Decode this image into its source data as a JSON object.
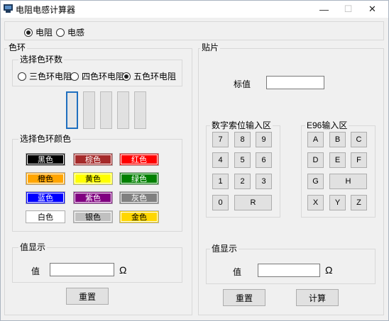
{
  "window": {
    "title": "电阻电感计算器",
    "min_glyph": "—",
    "max_glyph": "☐",
    "close_glyph": "✕"
  },
  "mode": {
    "options": [
      "电阻",
      "电感"
    ],
    "selected": "电阻"
  },
  "ring_panel": {
    "legend": "色环",
    "ring_count_group": {
      "legend": "选择色环数",
      "options": [
        "三色环电阻",
        "四色环电阻",
        "五色环电阻"
      ],
      "selected": "五色环电阻"
    },
    "color_group": {
      "legend": "选择色环颜色",
      "colors": [
        {
          "label": "黑色",
          "bg": "#000000",
          "fg": "#ffffff"
        },
        {
          "label": "棕色",
          "bg": "#a52a2a",
          "fg": "#ffffff"
        },
        {
          "label": "红色",
          "bg": "#ff0000",
          "fg": "#ffffff"
        },
        {
          "label": "橙色",
          "bg": "#ffa500",
          "fg": "#000000"
        },
        {
          "label": "黄色",
          "bg": "#ffff00",
          "fg": "#000000"
        },
        {
          "label": "绿色",
          "bg": "#008000",
          "fg": "#ffffff"
        },
        {
          "label": "蓝色",
          "bg": "#0000ff",
          "fg": "#ffffff"
        },
        {
          "label": "紫色",
          "bg": "#800080",
          "fg": "#ffffff"
        },
        {
          "label": "灰色",
          "bg": "#808080",
          "fg": "#ffffff"
        },
        {
          "label": "白色",
          "bg": "#ffffff",
          "fg": "#000000"
        },
        {
          "label": "银色",
          "bg": "#c0c0c0",
          "fg": "#000000"
        },
        {
          "label": "金色",
          "bg": "#ffd700",
          "fg": "#000000"
        }
      ]
    },
    "value_group": {
      "legend": "值显示",
      "value_label": "值",
      "value": "",
      "unit": "Ω"
    },
    "reset_button": "重置"
  },
  "smd_panel": {
    "legend": "贴片",
    "marking_label": "标值",
    "marking_value": "",
    "digit_group": {
      "legend": "数字索位输入区",
      "keys": [
        "7",
        "8",
        "9",
        "4",
        "5",
        "6",
        "1",
        "2",
        "3",
        "0",
        "R"
      ]
    },
    "e96_group": {
      "legend": "E96输入区",
      "keys": [
        "A",
        "B",
        "C",
        "D",
        "E",
        "F",
        "G",
        "H",
        "X",
        "Y",
        "Z"
      ]
    },
    "value_group": {
      "legend": "值显示",
      "value_label": "值",
      "value": "",
      "unit": "Ω"
    },
    "reset_button": "重置",
    "calc_button": "计算"
  }
}
